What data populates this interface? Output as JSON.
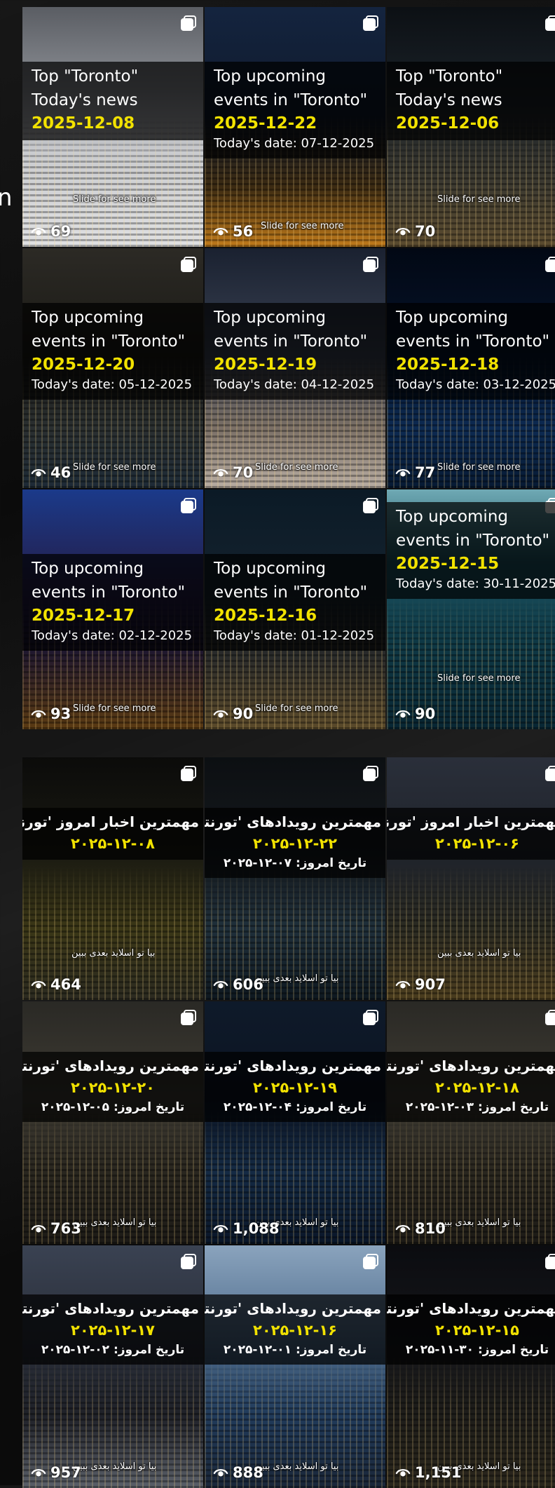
{
  "stray_char": "n",
  "en_posts": [
    {
      "title1": "Top \"Toronto\"",
      "title2": "Today's news",
      "date": "2025-12-08",
      "today": "",
      "views": "69",
      "slide": "Slide for see more",
      "bg": "linear-gradient(180deg,#5a5d63 0%,#8d9096 35%,#c9cbcf 60%,#dfe0e2 100%)"
    },
    {
      "title1": "Top upcoming",
      "title2": "events in \"Toronto\"",
      "date": "2025-12-22",
      "today": "Today's date: 07-12-2025",
      "views": "56",
      "slide": "Slide for see more",
      "bg": "linear-gradient(180deg,#14243f 0%,#0f1a2c 45%,#3b2a12 75%,#c07a1a 100%)"
    },
    {
      "title1": "Top \"Toronto\"",
      "title2": "Today's news",
      "date": "2025-12-06",
      "today": "",
      "views": "70",
      "slide": "Slide for see more",
      "bg": "linear-gradient(180deg,#0c1014 0%,#1b2229 40%,#3d3a30 75%,#5a4a2e 100%)"
    },
    {
      "title1": "Top upcoming",
      "title2": "events in \"Toronto\"",
      "date": "2025-12-20",
      "today": "Today's date: 05-12-2025",
      "views": "46",
      "slide": "Slide for see more",
      "bg": "linear-gradient(180deg,#2c2a25 0%,#1a1915 45%,#2a2f30 75%,#1d2a36 100%)"
    },
    {
      "title1": "Top upcoming",
      "title2": "events in \"Toronto\"",
      "date": "2025-12-19",
      "today": "Today's date: 04-12-2025",
      "views": "70",
      "slide": "Slide for see more",
      "bg": "linear-gradient(180deg,#1a2130 0%,#3a4253 45%,#7a6f66 75%,#b7aca2 100%)"
    },
    {
      "title1": "Top upcoming",
      "title2": "events in \"Toronto\"",
      "date": "2025-12-18",
      "today": "Today's date: 03-12-2025",
      "views": "77",
      "slide": "Slide for see more",
      "bg": "linear-gradient(180deg,#020814 0%,#06142b 45%,#0c2a52 75%,#071a33 100%)"
    },
    {
      "title1": "Top upcoming",
      "title2": "events in \"Toronto\"",
      "date": "2025-12-17",
      "today": "Today's date: 02-12-2025",
      "views": "93",
      "slide": "Slide for see more",
      "bg": "linear-gradient(180deg,#1b3a8a 0%,#241e4a 40%,#1b1530 65%,#5a3a12 100%)"
    },
    {
      "title1": "Top upcoming",
      "title2": "events in \"Toronto\"",
      "date": "2025-12-16",
      "today": "Today's date: 01-12-2025",
      "views": "90",
      "slide": "Slide for see more",
      "bg": "linear-gradient(180deg,#0b1a26 0%,#14222e 40%,#2a2b2a 70%,#5b4a2a 100%)"
    },
    {
      "title1": "Top upcoming",
      "title2": "events in \"Toronto\"",
      "date": "2025-12-15",
      "today": "Today's date: 30-11-2025",
      "views": "90",
      "slide": "Slide for see more",
      "bg": "linear-gradient(180deg,#6fa9b4 0%,#1d5563 30%,#0f3a47 60%,#082633 100%)"
    }
  ],
  "fa_posts": [
    {
      "title": "مهمترین اخبار امروز 'تورنتو'",
      "date": "۲۰۲۵-۱۲-۰۸",
      "today": "",
      "views": "464",
      "slide": "بیا تو اسلاید بعدی ببین",
      "bg": "linear-gradient(180deg,#0b0b0a 0%,#1a1a12 40%,#3a3616 70%,#2b2a20 100%)"
    },
    {
      "title": "مهمترین رویدادهای 'تورنتو'",
      "date": "۲۰۲۵-۱۲-۲۲",
      "today": "تاریخ امروز: ۰۷-۱۲-۲۰۲۵",
      "views": "606",
      "slide": "بیا تو اسلاید بعدی ببین",
      "bg": "linear-gradient(180deg,#0c0f12 0%,#15191d 40%,#1f2f3a 70%,#0e1820 100%)"
    },
    {
      "title": "مهمترین اخبار امروز 'تورنتو'",
      "date": "۲۰۲۵-۱۲-۰۶",
      "today": "",
      "views": "907",
      "slide": "بیا تو اسلاید بعدی ببین",
      "bg": "linear-gradient(180deg,#2a2f3a 0%,#1f232b 40%,#2a2a22 70%,#4a3c1e 100%)"
    },
    {
      "title": "مهمترین رویدادهای 'تورنتو'",
      "date": "۲۰۲۵-۱۲-۲۰",
      "today": "تاریخ امروز: ۰۵-۱۲-۲۰۲۵",
      "views": "763",
      "slide": "بیا تو اسلاید بعدی ببین",
      "bg": "linear-gradient(180deg,#2a2925 0%,#3e3b33 40%,#29261f 70%,#1c1a16 100%)"
    },
    {
      "title": "مهمترین رویدادهای 'تورنتو'",
      "date": "۲۰۲۵-۱۲-۱۹",
      "today": "تاریخ امروز: ۰۴-۱۲-۲۰۲۵",
      "views": "1,088",
      "slide": "بیا تو اسلاید بعدی ببین",
      "bg": "linear-gradient(180deg,#0e1a2a 0%,#0c1422 40%,#142a44 70%,#0a1628 100%)"
    },
    {
      "title": "مهمترین رویدادهای 'تورنتو'",
      "date": "۲۰۲۵-۱۲-۱۸",
      "today": "تاریخ امروز: ۰۳-۱۲-۲۰۲۵",
      "views": "810",
      "slide": "بیا تو اسلاید بعدی ببین",
      "bg": "linear-gradient(180deg,#2a2925 0%,#3e3b33 40%,#29261f 70%,#1c1a16 100%)"
    },
    {
      "title": "مهمترین رویدادهای 'تورنتو'",
      "date": "۲۰۲۵-۱۲-۱۷",
      "today": "تاریخ امروز: ۰۲-۱۲-۲۰۲۵",
      "views": "957",
      "slide": "بیا تو اسلاید بعدی ببین",
      "bg": "linear-gradient(180deg,#3a4252 0%,#2a2f3a 40%,#1f2128 70%,#5a5f68 100%)"
    },
    {
      "title": "مهمترین رویدادهای 'تورنتو'",
      "date": "۲۰۲۵-۱۲-۱۶",
      "today": "تاریخ امروز: ۰۱-۱۲-۲۰۲۵",
      "views": "888",
      "slide": "بیا تو اسلاید بعدی ببین",
      "bg": "linear-gradient(180deg,#8aa3bd 0%,#4e6c8c 40%,#203a5a 70%,#1a2638 100%)"
    },
    {
      "title": "مهمترین رویدادهای 'تورنتو'",
      "date": "۲۰۲۵-۱۲-۱۵",
      "today": "تاریخ امروز: ۳۰-۱۱-۲۰۲۵",
      "views": "1,151",
      "slide": "بیا تو اسلاید بعدی ببین",
      "bg": "linear-gradient(180deg,#0b0c10 0%,#15161a 40%,#1e1d1a 70%,#2a261c 100%)"
    }
  ]
}
